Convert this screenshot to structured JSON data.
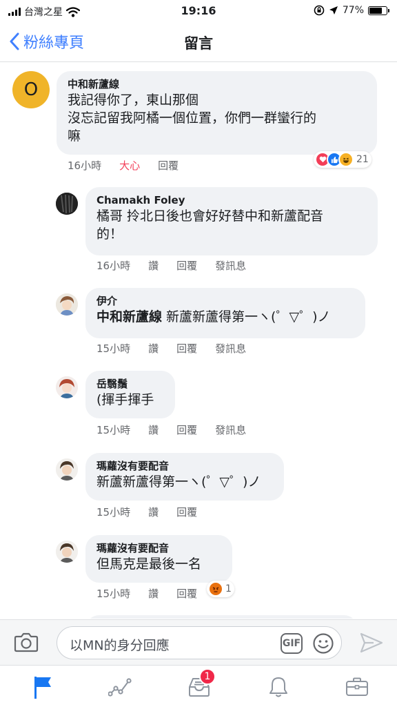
{
  "status_bar": {
    "carrier": "台灣之星",
    "time": "19:16",
    "battery": "77%",
    "battery_level": 0.77,
    "icons": [
      "signal-bars",
      "wifi",
      "rotation-lock",
      "location-arrow",
      "battery"
    ]
  },
  "nav": {
    "back_label": "粉絲專頁",
    "title": "留言"
  },
  "comments": [
    {
      "avatar_letter": "O",
      "author": "中和新蘆線",
      "lines": [
        "我記得你了，東山那個",
        "沒忘記留我阿橘一個位置，你們一群蠻行的",
        "嘛"
      ],
      "time": "16小時",
      "actions": [
        "大心",
        "回覆"
      ],
      "reactions": {
        "icons": [
          "love",
          "like",
          "haha"
        ],
        "count": "21"
      }
    },
    {
      "author": "Chamakh Foley",
      "lines": [
        "橘哥 拎北日後也會好好替中和新蘆配音",
        "的！"
      ],
      "time": "16小時",
      "actions": [
        "讚",
        "回覆",
        "發訊息"
      ]
    },
    {
      "author": "伊介",
      "tag": "中和新蘆線",
      "lines": [
        " 新蘆新蘆得第一ヽ(゜▽゜)ノ"
      ],
      "time": "15小時",
      "actions": [
        "讚",
        "回覆",
        "發訊息"
      ]
    },
    {
      "author": "岳翳鬚",
      "lines": [
        "(揮手揮手"
      ],
      "time": "15小時",
      "actions": [
        "讚",
        "回覆",
        "發訊息"
      ]
    },
    {
      "author": "瑪蘿沒有要配音",
      "lines": [
        "新蘆新蘆得第一ヽ(゜▽゜)ノ"
      ],
      "time": "15小時",
      "actions": [
        "讚",
        "回覆"
      ]
    },
    {
      "author": "瑪蘿沒有要配音",
      "lines": [
        "但馬克是最後一名"
      ],
      "time": "15小時",
      "actions": [
        "讚",
        "回覆"
      ],
      "reactions": {
        "icons": [
          "angry"
        ],
        "count": "1"
      }
    }
  ],
  "composer": {
    "placeholder": "以MN的身分回應",
    "gif_label": "GIF"
  },
  "tab_bar": {
    "tabs": [
      "page-flag",
      "insights",
      "inbox",
      "notifications",
      "tools"
    ],
    "inbox_badge": "1"
  },
  "colors": {
    "accent": "#4080ff",
    "love_reaction": "#f33e58",
    "bubble": "#f0f2f5",
    "badge": "#f02849",
    "avatar_o": "#f0b429"
  }
}
